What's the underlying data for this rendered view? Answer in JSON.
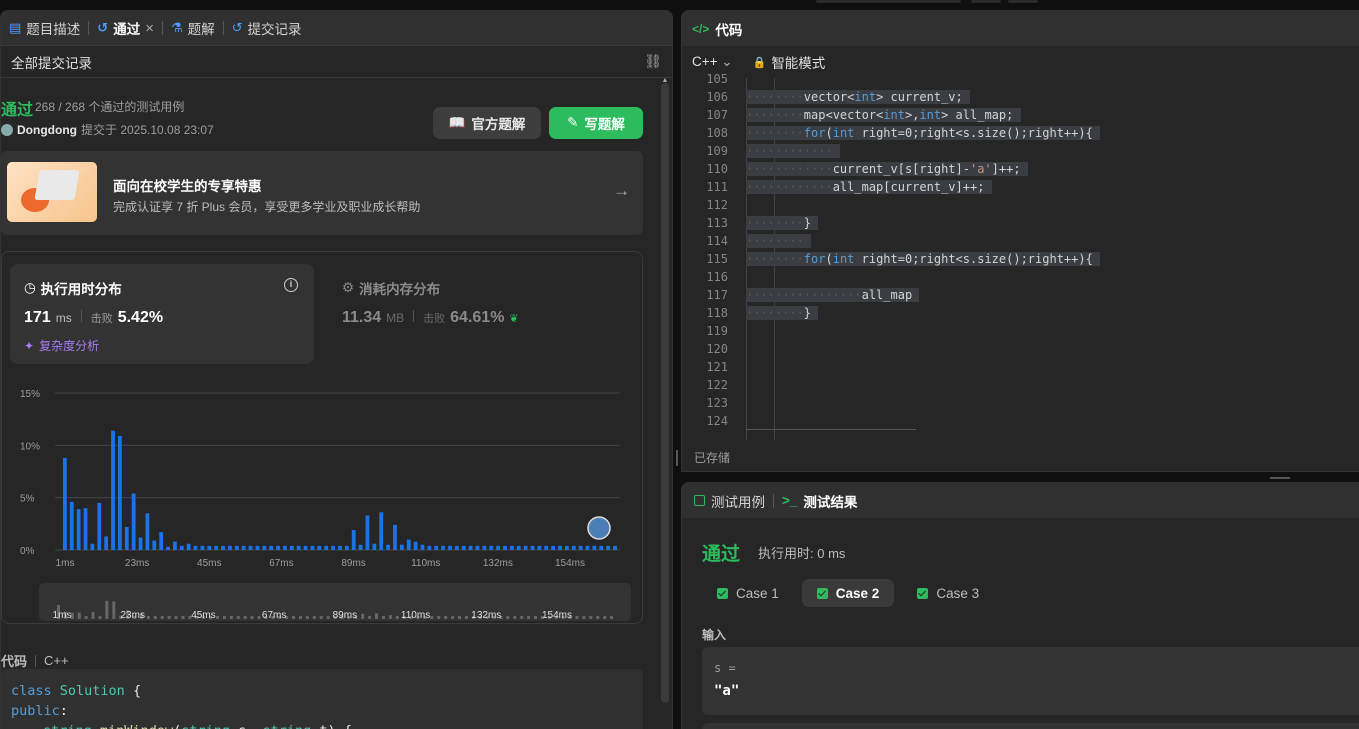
{
  "left_tabs": [
    {
      "label": "题目描述",
      "icon": "description-icon"
    },
    {
      "label": "通过",
      "icon": "history-icon",
      "active": true,
      "closable": "×"
    },
    {
      "label": "题解",
      "icon": "flask-icon"
    },
    {
      "label": "提交记录",
      "icon": "history-icon"
    }
  ],
  "subheader": {
    "title": "全部提交记录",
    "link_icon": "link-icon"
  },
  "submission": {
    "status": "通过",
    "cases": "268 / 268 个通过的测试用例",
    "user": "Dongdong",
    "submitted_at": "提交于 2025.10.08 23:07",
    "btn_official": "官方题解",
    "btn_write": "写题解"
  },
  "promo": {
    "title": "面向在校学生的专享特惠",
    "subtitle": "完成认证享 7 折 Plus 会员，享受更多学业及职业成长帮助",
    "arrow": "→"
  },
  "runtime": {
    "title": "执行用时分布",
    "value": "171",
    "unit": "ms",
    "beat_label": "击败",
    "beat": "5.42%",
    "complexity": "复杂度分析"
  },
  "memory": {
    "title": "消耗内存分布",
    "value": "11.34",
    "unit": "MB",
    "beat_label": "击败",
    "beat": "64.61%"
  },
  "chart_data": {
    "type": "bar",
    "ylabel": "",
    "xlabel": "",
    "ylim": [
      0,
      15
    ],
    "yticks": [
      "15%",
      "10%",
      "5%",
      "0%"
    ],
    "xticks": [
      "1ms",
      "23ms",
      "45ms",
      "67ms",
      "89ms",
      "110ms",
      "132ms",
      "154ms"
    ],
    "values": [
      8.8,
      4.6,
      3.9,
      4.0,
      0.6,
      4.5,
      1.3,
      11.4,
      10.9,
      2.2,
      5.4,
      1.2,
      3.5,
      0.9,
      1.7,
      0.3,
      0.8,
      0.4,
      0.6,
      0.4,
      0.4,
      0.4,
      0.4,
      0.4,
      0.4,
      0.4,
      0.4,
      0.4,
      0.4,
      0.4,
      0.4,
      0.4,
      0.4,
      0.4,
      0.4,
      0.4,
      0.4,
      0.4,
      0.4,
      0.4,
      0.4,
      0.4,
      1.9,
      0.5,
      3.3,
      0.6,
      3.6,
      0.5,
      2.4,
      0.5,
      1.0,
      0.8,
      0.5,
      0.4,
      0.4,
      0.4,
      0.4,
      0.4,
      0.4,
      0.4,
      0.4,
      0.4,
      0.4,
      0.4,
      0.4,
      0.4,
      0.4,
      0.4,
      0.4,
      0.4,
      0.4,
      0.4,
      0.4,
      0.4,
      0.4,
      0.4,
      0.4,
      0.4,
      0.4,
      0.4,
      0.4
    ],
    "color": "#1a73e8"
  },
  "code_label": {
    "title": "代码",
    "lang": "C++"
  },
  "code_preview": [
    "class Solution {",
    "public:",
    "    string minWindow(string s, string t) {"
  ],
  "editor": {
    "title": "代码",
    "lang": "C++",
    "lang_chevron": "⌄",
    "mode": "智能模式",
    "saved": "已存储",
    "lines": [
      {
        "n": "105",
        "text": ""
      },
      {
        "n": "106",
        "text": "vector<int> current_v;",
        "indent": 2
      },
      {
        "n": "107",
        "text": "map<vector<int>,int> all_map;",
        "indent": 2
      },
      {
        "n": "108",
        "text": "for(int right=0;right<s.size();right++){",
        "indent": 2
      },
      {
        "n": "109",
        "text": "",
        "indent": 3
      },
      {
        "n": "110",
        "text": "current_v[s[right]-'a']++;",
        "indent": 3
      },
      {
        "n": "111",
        "text": "all_map[current_v]++;",
        "indent": 3
      },
      {
        "n": "112",
        "text": ""
      },
      {
        "n": "113",
        "text": "}",
        "indent": 2
      },
      {
        "n": "114",
        "text": "",
        "indent": 2
      },
      {
        "n": "115",
        "text": "for(int right=0;right<s.size();right++){",
        "indent": 2
      },
      {
        "n": "116",
        "text": ""
      },
      {
        "n": "117",
        "text": "all_map",
        "indent": 4
      },
      {
        "n": "118",
        "text": "}",
        "indent": 2
      },
      {
        "n": "119",
        "text": ""
      },
      {
        "n": "120",
        "text": ""
      },
      {
        "n": "121",
        "text": ""
      },
      {
        "n": "122",
        "text": ""
      },
      {
        "n": "123",
        "text": ""
      },
      {
        "n": "124",
        "text": ""
      }
    ]
  },
  "testpanel": {
    "tab_cases": "测试用例",
    "tab_result": "测试结果",
    "result": "通过",
    "time": "执行用时: 0 ms",
    "cases": [
      "Case 1",
      "Case 2",
      "Case 3"
    ],
    "active_case": 1,
    "input_label": "输入",
    "input_name": "s =",
    "input_value": "\"a\""
  }
}
